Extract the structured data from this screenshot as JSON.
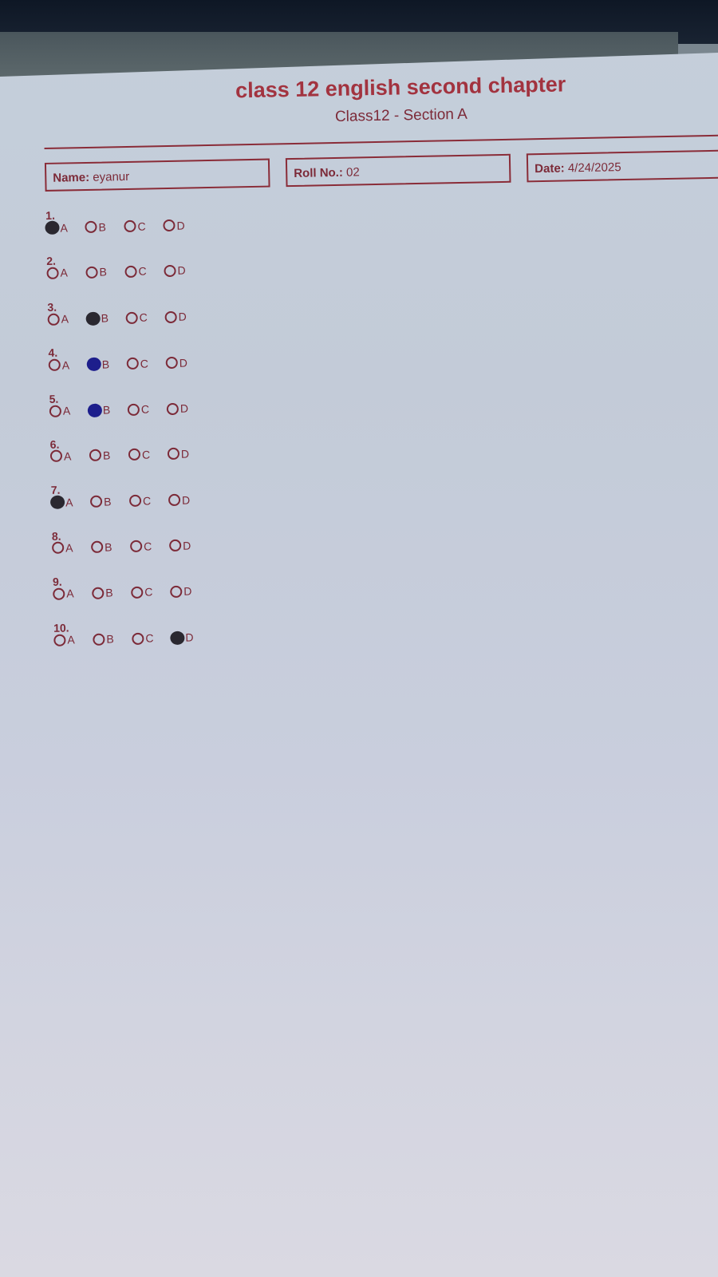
{
  "sheet": {
    "title": "class 12 english second chapter",
    "subtitle": "Class12 - Section A",
    "name_label": "Name:",
    "name_value": "eyanur",
    "roll_label": "Roll No.:",
    "roll_value": "02",
    "date_label": "Date:",
    "date_value": "4/24/2025"
  },
  "options": [
    "A",
    "B",
    "C",
    "D"
  ],
  "fill_colors": {
    "dark": "#2a2830",
    "blue": "#1d1e8c"
  },
  "questions": [
    {
      "number": "1.",
      "selected": "A",
      "ink": "dark"
    },
    {
      "number": "2.",
      "selected": null,
      "ink": null
    },
    {
      "number": "3.",
      "selected": "B",
      "ink": "dark"
    },
    {
      "number": "4.",
      "selected": "B",
      "ink": "blue"
    },
    {
      "number": "5.",
      "selected": "B",
      "ink": "blue"
    },
    {
      "number": "6.",
      "selected": null,
      "ink": null
    },
    {
      "number": "7.",
      "selected": "A",
      "ink": "dark"
    },
    {
      "number": "8.",
      "selected": null,
      "ink": null
    },
    {
      "number": "9.",
      "selected": null,
      "ink": null
    },
    {
      "number": "10.",
      "selected": "D",
      "ink": "dark"
    }
  ]
}
